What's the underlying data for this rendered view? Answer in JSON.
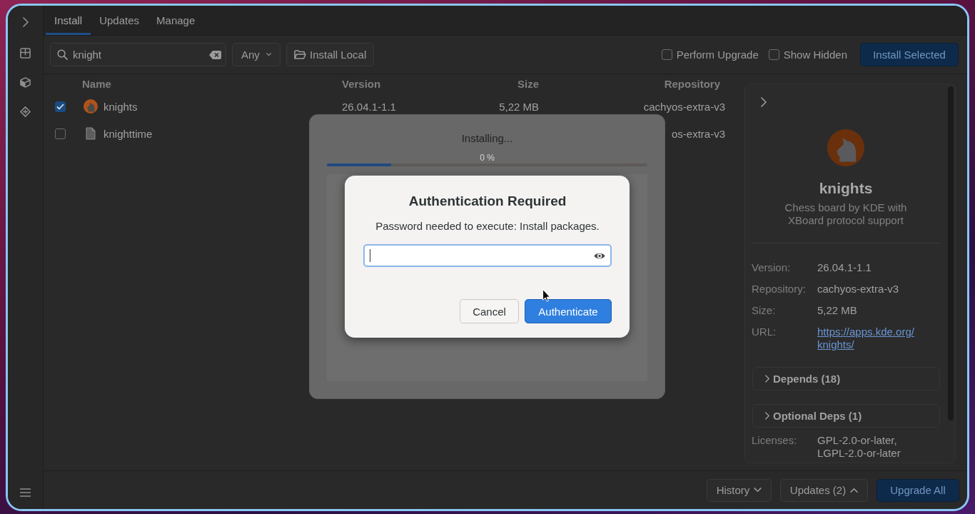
{
  "tabs": [
    {
      "label": "Install",
      "selected": true
    },
    {
      "label": "Updates",
      "selected": false
    },
    {
      "label": "Manage",
      "selected": false
    }
  ],
  "toolbar": {
    "search": {
      "value": "knight"
    },
    "filter": {
      "value": "Any"
    },
    "install_local": {
      "label": "Install Local"
    },
    "options": [
      {
        "label": "Perform Upgrade",
        "checked": false
      },
      {
        "label": "Show Hidden",
        "checked": false
      }
    ],
    "install_selected": {
      "label": "Install Selected",
      "kind": "primary"
    }
  },
  "table": {
    "columns": [
      "Name",
      "Version",
      "Size",
      "Repository"
    ],
    "rows": [
      {
        "checked": true,
        "kind": "app",
        "name": "knights",
        "version": "26.04.1-1.1",
        "size": "5,22 MB",
        "repository": "cachyos-extra-v3"
      },
      {
        "checked": false,
        "kind": "file",
        "name": "knighttime",
        "repository": "os-extra-v3"
      }
    ]
  },
  "details": {
    "name": "knights",
    "description": "Chess board by KDE with XBoard protocol support",
    "fields": [
      {
        "label": "Version:",
        "value": "26.04.1-1.1",
        "kind": "text"
      },
      {
        "label": "Repository:",
        "value": "cachyos-extra-v3",
        "kind": "text"
      },
      {
        "label": "Size:",
        "value": "5,22 MB",
        "kind": "text"
      },
      {
        "label": "URL:",
        "value": "https://apps.kde.org/knights/",
        "kind": "link"
      }
    ],
    "sections": [
      {
        "label": "Depends (18)",
        "expanded": false
      },
      {
        "label": "Optional Deps (1)",
        "expanded": false
      }
    ],
    "licenses": {
      "label": "Licenses:",
      "value": "GPL-2.0-or-later, LGPL-2.0-or-later"
    }
  },
  "bottom_bar": {
    "buttons": [
      {
        "label": "History",
        "kind": "dropdown"
      },
      {
        "label": "Updates (2)",
        "kind": "dropup"
      },
      {
        "label": "Upgrade All",
        "kind": "primary"
      }
    ]
  },
  "progress_dialog": {
    "title": "Installing...",
    "percent": "0 %",
    "level": 0.2
  },
  "auth_dialog": {
    "title": "Authentication Required",
    "message": "Password needed to execute: Install packages.",
    "password": {
      "focused": true
    },
    "buttons": [
      {
        "label": "Cancel",
        "kind": "secondary"
      },
      {
        "label": "Authenticate",
        "kind": "primary"
      }
    ]
  }
}
